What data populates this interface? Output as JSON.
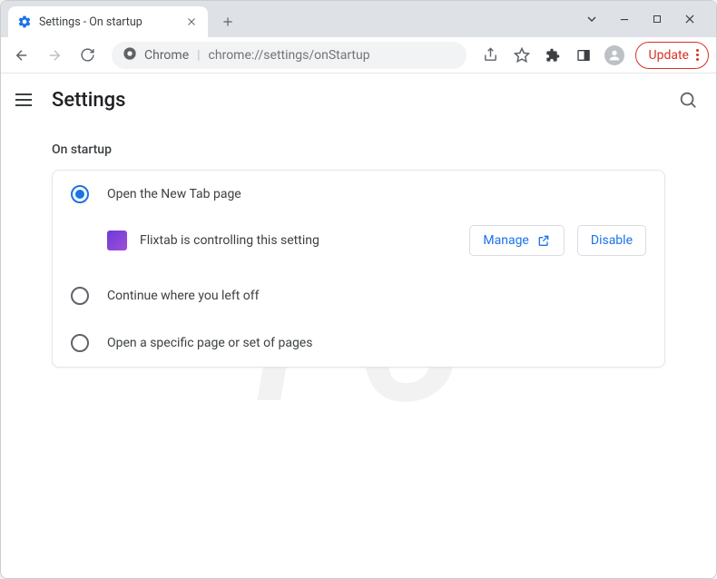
{
  "tab": {
    "title": "Settings - On startup"
  },
  "omnibox": {
    "origin_label": "Chrome",
    "url": "chrome://settings/onStartup"
  },
  "update_button": "Update",
  "settings": {
    "title": "Settings",
    "section_title": "On startup",
    "options": [
      {
        "label": "Open the New Tab page",
        "checked": true
      },
      {
        "label": "Continue where you left off",
        "checked": false
      },
      {
        "label": "Open a specific page or set of pages",
        "checked": false
      }
    ],
    "extension_notice": {
      "extension_name": "Flixtab",
      "text": "Flixtab is controlling this setting",
      "manage_label": "Manage",
      "disable_label": "Disable"
    }
  },
  "watermark": "PCrisk.com"
}
